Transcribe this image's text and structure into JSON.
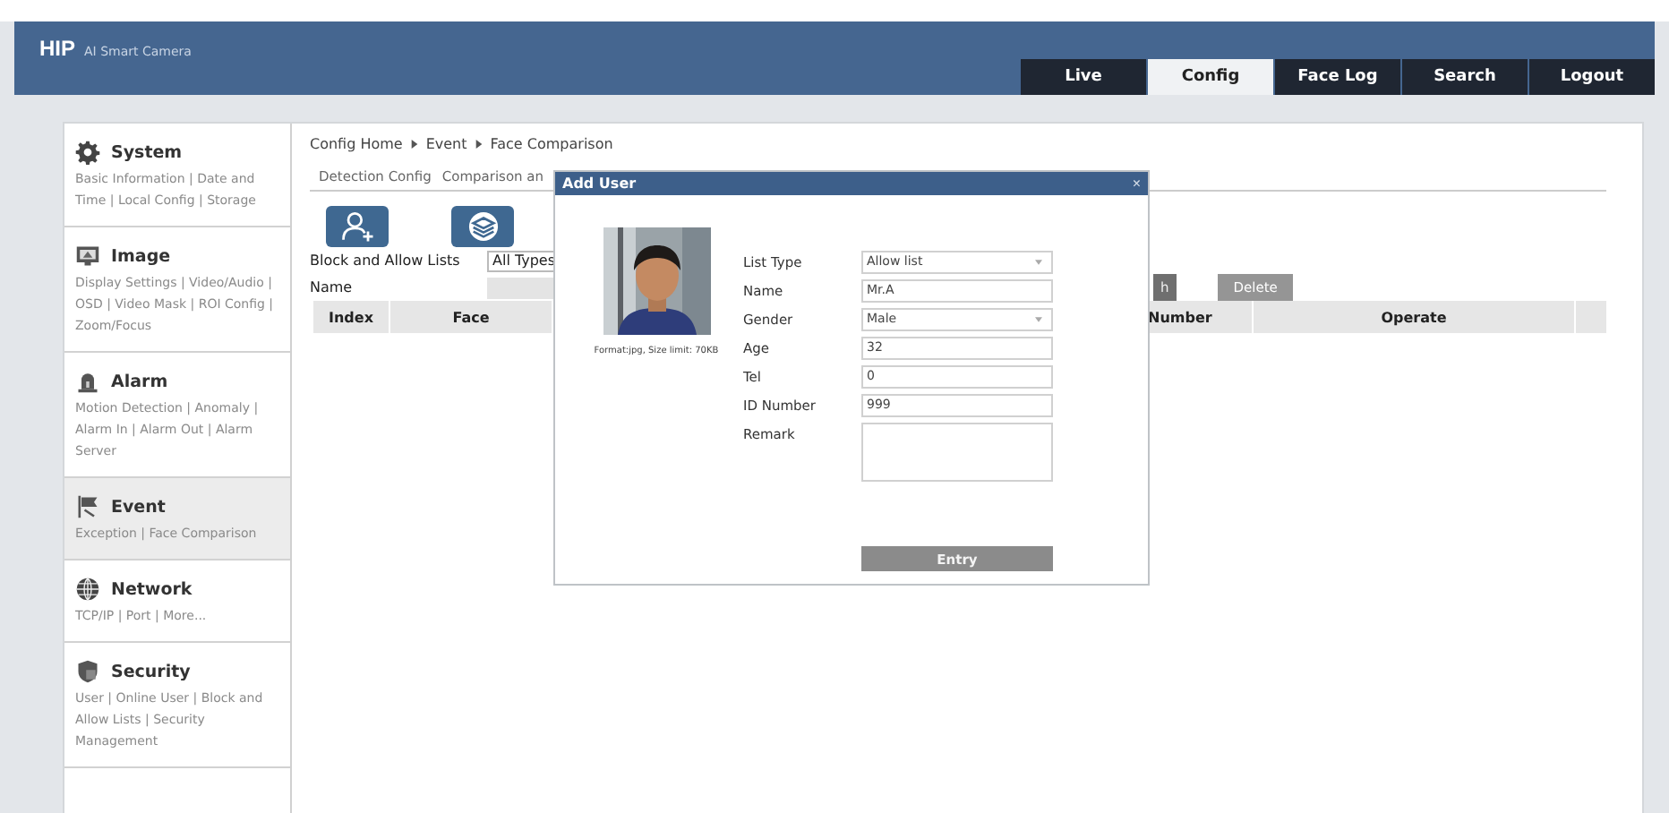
{
  "header": {
    "logo": "HIP",
    "subtitle": "AI Smart Camera",
    "nav": [
      {
        "label": "Live",
        "selected": false
      },
      {
        "label": "Config",
        "selected": true
      },
      {
        "label": "Face Log",
        "selected": false
      },
      {
        "label": "Search",
        "selected": false
      },
      {
        "label": "Logout",
        "selected": false
      }
    ]
  },
  "sidebar": {
    "items": [
      {
        "title": "System",
        "links": "Basic Information | Date and Time | Local Config | Storage",
        "selected": false
      },
      {
        "title": "Image",
        "links": "Display Settings | Video/Audio | OSD | Video Mask | ROI Config | Zoom/Focus",
        "selected": false
      },
      {
        "title": "Alarm",
        "links": "Motion Detection | Anomaly | Alarm In | Alarm Out | Alarm Server",
        "selected": false
      },
      {
        "title": "Event",
        "links": "Exception | Face Comparison",
        "selected": true
      },
      {
        "title": "Network",
        "links": "TCP/IP | Port | More...",
        "selected": false
      },
      {
        "title": "Security",
        "links": "User | Online User | Block and Allow Lists | Security Management",
        "selected": false
      }
    ]
  },
  "breadcrumb": [
    "Config Home",
    "Event",
    "Face Comparison"
  ],
  "tabs": [
    "Detection Config",
    "Comparison an"
  ],
  "filters": {
    "list_label": "Block and Allow Lists",
    "list_value": "All Types",
    "name_label": "Name"
  },
  "buttons": [
    {
      "label": "h",
      "disabled": false
    },
    {
      "label": "Delete",
      "disabled": true
    }
  ],
  "table": {
    "columns": [
      "Index",
      "Face",
      "Number",
      "Operate"
    ]
  },
  "dialog": {
    "title": "Add User",
    "close": "×",
    "caption": "Format:jpg, Size limit: 70KB",
    "fields": [
      {
        "kind": "select",
        "label": "List Type",
        "value": "Allow list"
      },
      {
        "kind": "input",
        "label": "Name",
        "value": "Mr.A"
      },
      {
        "kind": "select",
        "label": "Gender",
        "value": "Male"
      },
      {
        "kind": "input",
        "label": "Age",
        "value": "32"
      },
      {
        "kind": "input",
        "label": "Tel",
        "value": "0"
      },
      {
        "kind": "input",
        "label": "ID Number",
        "value": "999"
      },
      {
        "kind": "textarea",
        "label": "Remark"
      }
    ],
    "submit": "Entry"
  }
}
